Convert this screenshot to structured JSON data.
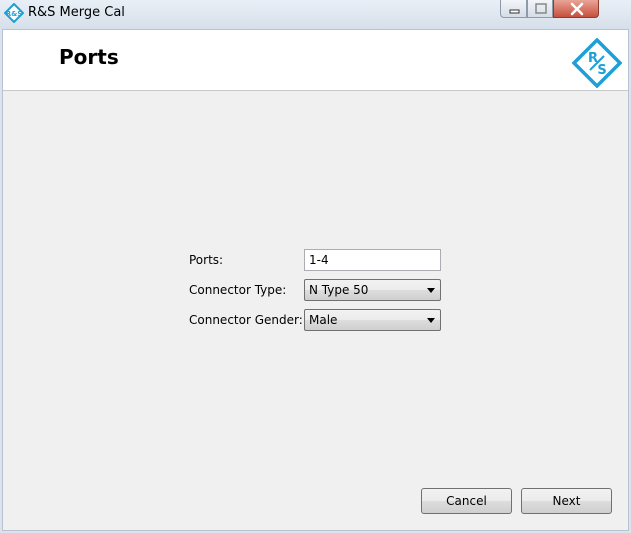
{
  "window": {
    "title": "R&S Merge Cal",
    "logo_text": "R&S",
    "controls": {
      "minimize": "minimize",
      "maximize": "maximize",
      "close": "close"
    }
  },
  "header": {
    "title": "Ports",
    "logo_text": "R&S"
  },
  "form": {
    "ports_label": "Ports:",
    "ports_value": "1-4",
    "connector_type_label": "Connector Type:",
    "connector_type_value": "N Type 50",
    "connector_gender_label": "Connector Gender:",
    "connector_gender_value": "Male"
  },
  "footer": {
    "cancel_label": "Cancel",
    "next_label": "Next"
  },
  "colors": {
    "brand": "#1e9fd6",
    "client_bg": "#f0f0f0",
    "header_bg": "#ffffff"
  }
}
